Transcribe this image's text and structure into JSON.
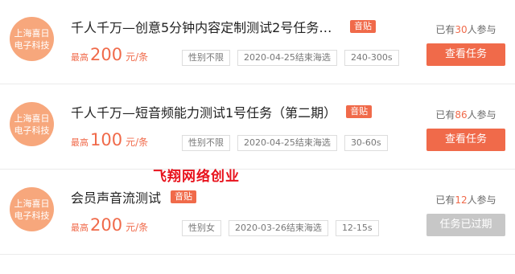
{
  "colors": {
    "accent": "#f06a4a",
    "avatar_bg": "#f7a77c",
    "expired_btn": "#c7c7c7",
    "overlay": "#e8121c"
  },
  "tasks": [
    {
      "avatar_line1": "上海喜日",
      "avatar_line2": "电子科技",
      "title": "千人千万—创意5分钟内容定制测试2号任务（…",
      "tag": "音贴",
      "price_prefix": "最高",
      "price_value": "200",
      "price_unit": "元/条",
      "chips": [
        "性别不限",
        "2020-04-25结束海选",
        "240-300s"
      ],
      "joined_prefix": "已有",
      "joined_count": "30",
      "joined_suffix": "人参与",
      "button_label": "查看任务",
      "button_state": "active"
    },
    {
      "avatar_line1": "上海喜日",
      "avatar_line2": "电子科技",
      "title": "千人千万—短音频能力测试1号任务（第二期）",
      "tag": "音贴",
      "price_prefix": "最高",
      "price_value": "100",
      "price_unit": "元/条",
      "chips": [
        "性别不限",
        "2020-04-25结束海选",
        "30-60s"
      ],
      "joined_prefix": "已有",
      "joined_count": "86",
      "joined_suffix": "人参与",
      "button_label": "查看任务",
      "button_state": "active"
    },
    {
      "avatar_line1": "上海喜日",
      "avatar_line2": "电子科技",
      "title": "会员声音流测试",
      "tag": "音贴",
      "price_prefix": "最高",
      "price_value": "200",
      "price_unit": "元/条",
      "chips": [
        "性别女",
        "2020-03-26结束海选",
        "12-15s"
      ],
      "joined_prefix": "已有",
      "joined_count": "12",
      "joined_suffix": "人参与",
      "button_label": "任务已过期",
      "button_state": "expired"
    }
  ],
  "overlay_text": "飞翔网络创业"
}
